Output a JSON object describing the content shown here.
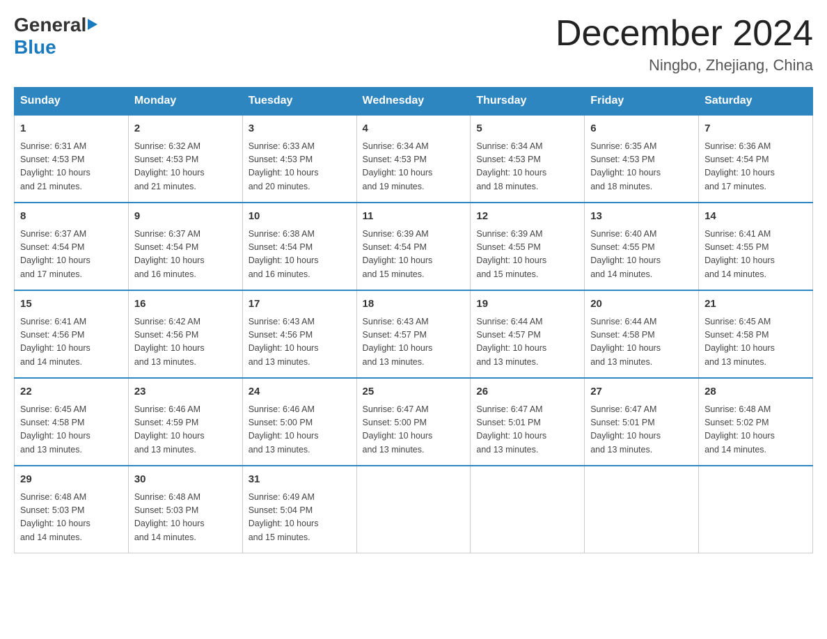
{
  "header": {
    "logo_general": "General",
    "logo_blue": "Blue",
    "month_title": "December 2024",
    "location": "Ningbo, Zhejiang, China"
  },
  "days_of_week": [
    "Sunday",
    "Monday",
    "Tuesday",
    "Wednesday",
    "Thursday",
    "Friday",
    "Saturday"
  ],
  "weeks": [
    [
      {
        "day": "1",
        "sunrise": "6:31 AM",
        "sunset": "4:53 PM",
        "daylight": "10 hours and 21 minutes."
      },
      {
        "day": "2",
        "sunrise": "6:32 AM",
        "sunset": "4:53 PM",
        "daylight": "10 hours and 21 minutes."
      },
      {
        "day": "3",
        "sunrise": "6:33 AM",
        "sunset": "4:53 PM",
        "daylight": "10 hours and 20 minutes."
      },
      {
        "day": "4",
        "sunrise": "6:34 AM",
        "sunset": "4:53 PM",
        "daylight": "10 hours and 19 minutes."
      },
      {
        "day": "5",
        "sunrise": "6:34 AM",
        "sunset": "4:53 PM",
        "daylight": "10 hours and 18 minutes."
      },
      {
        "day": "6",
        "sunrise": "6:35 AM",
        "sunset": "4:53 PM",
        "daylight": "10 hours and 18 minutes."
      },
      {
        "day": "7",
        "sunrise": "6:36 AM",
        "sunset": "4:54 PM",
        "daylight": "10 hours and 17 minutes."
      }
    ],
    [
      {
        "day": "8",
        "sunrise": "6:37 AM",
        "sunset": "4:54 PM",
        "daylight": "10 hours and 17 minutes."
      },
      {
        "day": "9",
        "sunrise": "6:37 AM",
        "sunset": "4:54 PM",
        "daylight": "10 hours and 16 minutes."
      },
      {
        "day": "10",
        "sunrise": "6:38 AM",
        "sunset": "4:54 PM",
        "daylight": "10 hours and 16 minutes."
      },
      {
        "day": "11",
        "sunrise": "6:39 AM",
        "sunset": "4:54 PM",
        "daylight": "10 hours and 15 minutes."
      },
      {
        "day": "12",
        "sunrise": "6:39 AM",
        "sunset": "4:55 PM",
        "daylight": "10 hours and 15 minutes."
      },
      {
        "day": "13",
        "sunrise": "6:40 AM",
        "sunset": "4:55 PM",
        "daylight": "10 hours and 14 minutes."
      },
      {
        "day": "14",
        "sunrise": "6:41 AM",
        "sunset": "4:55 PM",
        "daylight": "10 hours and 14 minutes."
      }
    ],
    [
      {
        "day": "15",
        "sunrise": "6:41 AM",
        "sunset": "4:56 PM",
        "daylight": "10 hours and 14 minutes."
      },
      {
        "day": "16",
        "sunrise": "6:42 AM",
        "sunset": "4:56 PM",
        "daylight": "10 hours and 13 minutes."
      },
      {
        "day": "17",
        "sunrise": "6:43 AM",
        "sunset": "4:56 PM",
        "daylight": "10 hours and 13 minutes."
      },
      {
        "day": "18",
        "sunrise": "6:43 AM",
        "sunset": "4:57 PM",
        "daylight": "10 hours and 13 minutes."
      },
      {
        "day": "19",
        "sunrise": "6:44 AM",
        "sunset": "4:57 PM",
        "daylight": "10 hours and 13 minutes."
      },
      {
        "day": "20",
        "sunrise": "6:44 AM",
        "sunset": "4:58 PM",
        "daylight": "10 hours and 13 minutes."
      },
      {
        "day": "21",
        "sunrise": "6:45 AM",
        "sunset": "4:58 PM",
        "daylight": "10 hours and 13 minutes."
      }
    ],
    [
      {
        "day": "22",
        "sunrise": "6:45 AM",
        "sunset": "4:58 PM",
        "daylight": "10 hours and 13 minutes."
      },
      {
        "day": "23",
        "sunrise": "6:46 AM",
        "sunset": "4:59 PM",
        "daylight": "10 hours and 13 minutes."
      },
      {
        "day": "24",
        "sunrise": "6:46 AM",
        "sunset": "5:00 PM",
        "daylight": "10 hours and 13 minutes."
      },
      {
        "day": "25",
        "sunrise": "6:47 AM",
        "sunset": "5:00 PM",
        "daylight": "10 hours and 13 minutes."
      },
      {
        "day": "26",
        "sunrise": "6:47 AM",
        "sunset": "5:01 PM",
        "daylight": "10 hours and 13 minutes."
      },
      {
        "day": "27",
        "sunrise": "6:47 AM",
        "sunset": "5:01 PM",
        "daylight": "10 hours and 13 minutes."
      },
      {
        "day": "28",
        "sunrise": "6:48 AM",
        "sunset": "5:02 PM",
        "daylight": "10 hours and 14 minutes."
      }
    ],
    [
      {
        "day": "29",
        "sunrise": "6:48 AM",
        "sunset": "5:03 PM",
        "daylight": "10 hours and 14 minutes."
      },
      {
        "day": "30",
        "sunrise": "6:48 AM",
        "sunset": "5:03 PM",
        "daylight": "10 hours and 14 minutes."
      },
      {
        "day": "31",
        "sunrise": "6:49 AM",
        "sunset": "5:04 PM",
        "daylight": "10 hours and 15 minutes."
      },
      {
        "day": "",
        "sunrise": "",
        "sunset": "",
        "daylight": ""
      },
      {
        "day": "",
        "sunrise": "",
        "sunset": "",
        "daylight": ""
      },
      {
        "day": "",
        "sunrise": "",
        "sunset": "",
        "daylight": ""
      },
      {
        "day": "",
        "sunrise": "",
        "sunset": "",
        "daylight": ""
      }
    ]
  ],
  "labels": {
    "sunrise": "Sunrise:",
    "sunset": "Sunset:",
    "daylight": "Daylight:"
  }
}
